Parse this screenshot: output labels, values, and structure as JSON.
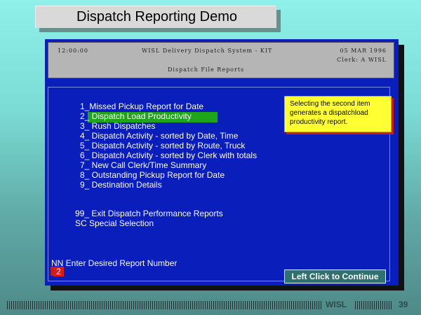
{
  "slide": {
    "title": "Dispatch Reporting Demo",
    "footer_brand": "WISL",
    "page_number": "39"
  },
  "terminal": {
    "time": "12:00:00",
    "system_name": "WISL Delivery Dispatch System - KIT",
    "date": "05 MAR 1996",
    "clerk": "Clerk: A WISL",
    "screen_title": "Dispatch File Reports"
  },
  "menu": {
    "items": [
      "1_Missed Pickup Report for Date",
      "2_ Dispatch Load Productivity",
      "3_ Rush Dispatches",
      "4_ Dispatch Activity - sorted by Date, Time",
      "5_ Dispatch Activity - sorted by Route, Truck",
      "6_ Dispatch Activity - sorted by Clerk with totals",
      "7_ New Call Clerk/Time Summary",
      "8_ Outstanding Pickup Report for Date",
      "9_ Destination Details"
    ],
    "extra": [
      "99_ Exit Dispatch Performance Reports",
      "SC  Special Selection"
    ],
    "highlighted_index": 2
  },
  "callout": {
    "text": "Selecting the second item generates a dispatchload productivity report."
  },
  "prompt": {
    "label": "NN Enter Desired Report Number",
    "value": "2"
  },
  "continue_button": {
    "label": "Left Click to Continue"
  },
  "colors": {
    "window_blue": "#0a1ebc",
    "highlight_green": "#1fa51a",
    "callout_yellow": "#ffff33",
    "entry_red": "#d81c1c"
  }
}
